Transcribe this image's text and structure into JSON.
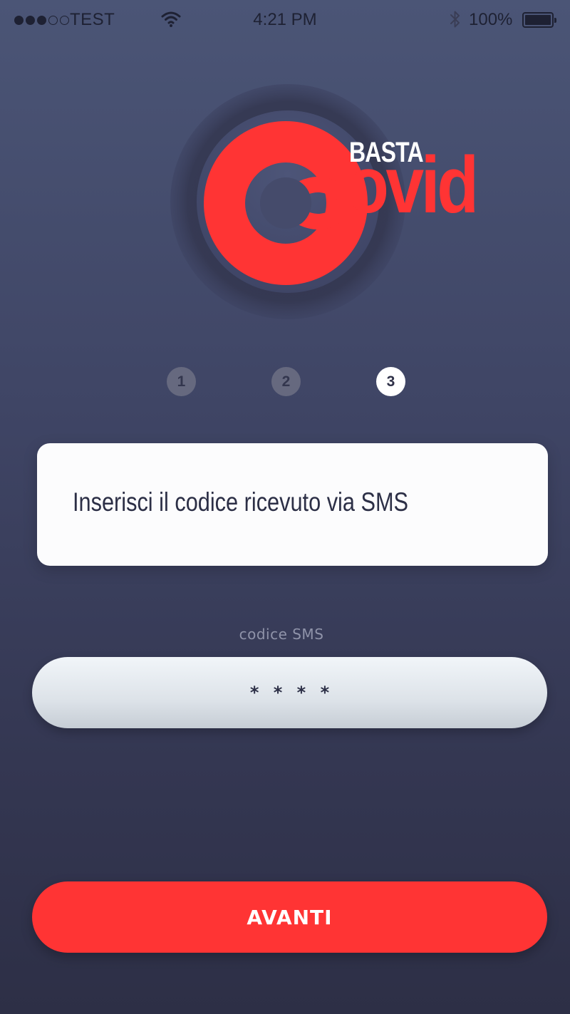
{
  "status_bar": {
    "carrier": "TEST",
    "signal_bars": 3,
    "signal_bars_total": 5,
    "time": "4:21 PM",
    "battery_percent": "100%",
    "icons": [
      "signal-dots-icon",
      "wifi-icon",
      "bluetooth-icon",
      "battery-icon"
    ]
  },
  "logo": {
    "prefix": "BASTA",
    "suffix": "ovid",
    "accent_color": "#ff3434"
  },
  "steps": {
    "items": [
      "1",
      "2",
      "3"
    ],
    "active_index": 2
  },
  "card": {
    "instruction": "Inserisci il codice ricevuto via SMS"
  },
  "sms_field": {
    "label": "codice SMS",
    "placeholder": "* * * *"
  },
  "actions": {
    "next_label": "AVANTI"
  },
  "colors": {
    "background_top": "#4b5576",
    "background_bottom": "#2d2f46",
    "accent": "#ff3434",
    "card": "#fcfcfd"
  }
}
